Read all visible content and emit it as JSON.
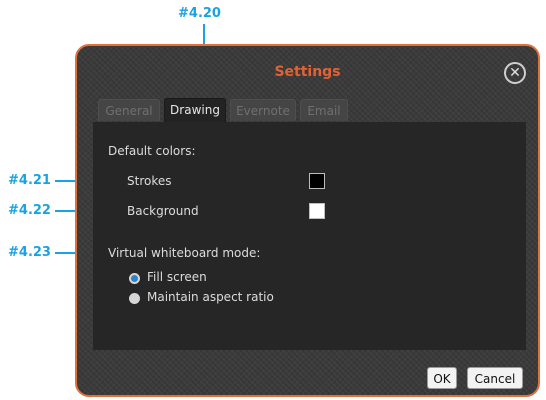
{
  "callouts": {
    "tab": "#4.20",
    "strokes": "#4.21",
    "background": "#4.22",
    "mode": "#4.23"
  },
  "dialog": {
    "title": "Settings",
    "close_icon": "close-icon"
  },
  "tabs": [
    {
      "label": "General",
      "active": false
    },
    {
      "label": "Drawing",
      "active": true
    },
    {
      "label": "Evernote",
      "active": false
    },
    {
      "label": "Email",
      "active": false
    }
  ],
  "drawing": {
    "default_colors_heading": "Default colors:",
    "strokes_label": "Strokes",
    "strokes_color": "#000000",
    "background_label": "Background",
    "background_color": "#ffffff",
    "mode_heading": "Virtual whiteboard mode:",
    "modes": [
      {
        "label": "Fill screen",
        "selected": true
      },
      {
        "label": "Maintain aspect ratio",
        "selected": false
      }
    ]
  },
  "buttons": {
    "ok": "OK",
    "cancel": "Cancel"
  },
  "colors": {
    "accent": "#1aa3e0",
    "title": "#e26233",
    "frame": "#e0703c"
  }
}
